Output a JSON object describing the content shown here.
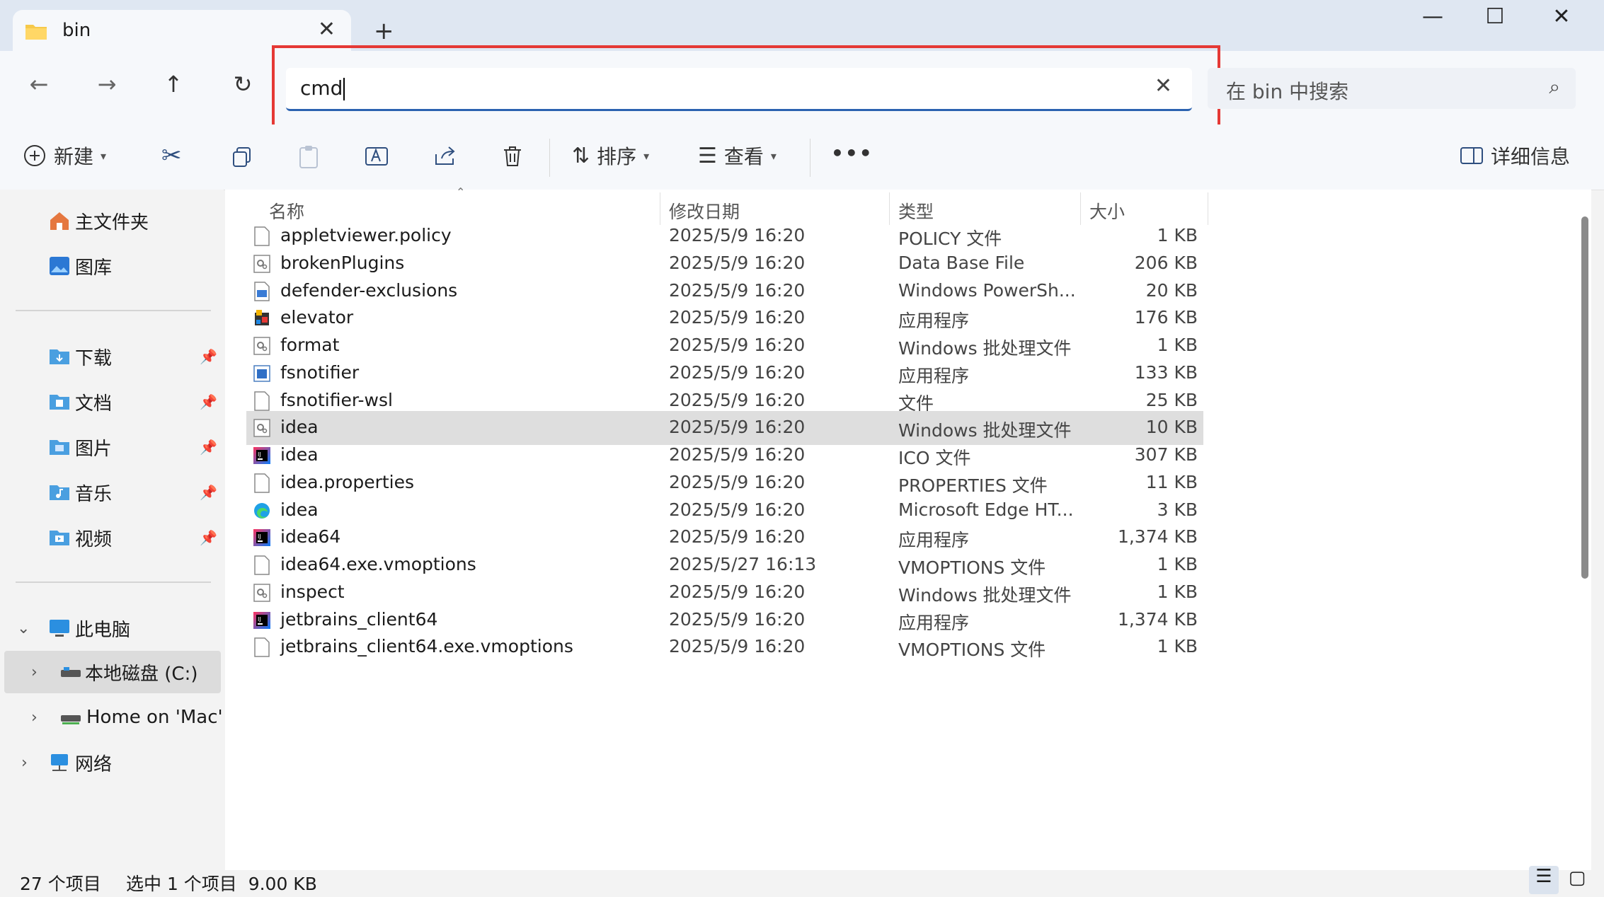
{
  "window": {
    "tab_title": "bin",
    "tab_close": "✕",
    "new_tab": "+",
    "minimize": "—",
    "maximize": "☐",
    "close": "✕"
  },
  "nav": {
    "back": "←",
    "forward": "→",
    "up": "↑",
    "refresh": "↻",
    "address_value": "cmd",
    "address_clear": "✕",
    "search_placeholder": "在 bin 中搜索",
    "search_icon": "⌕"
  },
  "toolbar": {
    "new_label": "新建",
    "sort_label": "排序",
    "view_label": "查看",
    "more": "•••",
    "details_label": "详细信息",
    "icons": [
      "plus-circle-icon",
      "cut-icon",
      "copy-icon",
      "paste-icon",
      "rename-icon",
      "share-icon",
      "delete-icon"
    ]
  },
  "sidebar": {
    "quick": [
      {
        "label": "主文件夹",
        "icon": "home-icon"
      },
      {
        "label": "图库",
        "icon": "gallery-icon"
      }
    ],
    "pinned": [
      {
        "label": "下载",
        "icon": "folder-download-icon"
      },
      {
        "label": "文档",
        "icon": "folder-docs-icon"
      },
      {
        "label": "图片",
        "icon": "folder-pictures-icon"
      },
      {
        "label": "音乐",
        "icon": "folder-music-icon"
      },
      {
        "label": "视频",
        "icon": "folder-video-icon"
      }
    ],
    "this_pc": "此电脑",
    "drive_c": "本地磁盘 (C:)",
    "home_mac": "Home on 'Mac' (",
    "network": "网络"
  },
  "columns": {
    "name": "名称",
    "date": "修改日期",
    "type": "类型",
    "size": "大小"
  },
  "files": [
    {
      "name": "appletviewer.policy",
      "date": "2025/5/9 16:20",
      "type": "POLICY 文件",
      "size": "1 KB",
      "icon": "blank"
    },
    {
      "name": "brokenPlugins",
      "date": "2025/5/9 16:20",
      "type": "Data Base File",
      "size": "206 KB",
      "icon": "gear"
    },
    {
      "name": "defender-exclusions",
      "date": "2025/5/9 16:20",
      "type": "Windows PowerSh...",
      "size": "20 KB",
      "icon": "ps"
    },
    {
      "name": "elevator",
      "date": "2025/5/9 16:20",
      "type": "应用程序",
      "size": "176 KB",
      "icon": "app"
    },
    {
      "name": "format",
      "date": "2025/5/9 16:20",
      "type": "Windows 批处理文件",
      "size": "1 KB",
      "icon": "gear"
    },
    {
      "name": "fsnotifier",
      "date": "2025/5/9 16:20",
      "type": "应用程序",
      "size": "133 KB",
      "icon": "win"
    },
    {
      "name": "fsnotifier-wsl",
      "date": "2025/5/9 16:20",
      "type": "文件",
      "size": "25 KB",
      "icon": "blank"
    },
    {
      "name": "idea",
      "date": "2025/5/9 16:20",
      "type": "Windows 批处理文件",
      "size": "10 KB",
      "icon": "gear"
    },
    {
      "name": "idea",
      "date": "2025/5/9 16:20",
      "type": "ICO 文件",
      "size": "307 KB",
      "icon": "jb"
    },
    {
      "name": "idea.properties",
      "date": "2025/5/9 16:20",
      "type": "PROPERTIES 文件",
      "size": "11 KB",
      "icon": "blank"
    },
    {
      "name": "idea",
      "date": "2025/5/9 16:20",
      "type": "Microsoft Edge HT...",
      "size": "3 KB",
      "icon": "edge"
    },
    {
      "name": "idea64",
      "date": "2025/5/9 16:20",
      "type": "应用程序",
      "size": "1,374 KB",
      "icon": "jb"
    },
    {
      "name": "idea64.exe.vmoptions",
      "date": "2025/5/27 16:13",
      "type": "VMOPTIONS 文件",
      "size": "1 KB",
      "icon": "blank"
    },
    {
      "name": "inspect",
      "date": "2025/5/9 16:20",
      "type": "Windows 批处理文件",
      "size": "1 KB",
      "icon": "gear"
    },
    {
      "name": "jetbrains_client64",
      "date": "2025/5/9 16:20",
      "type": "应用程序",
      "size": "1,374 KB",
      "icon": "jb"
    },
    {
      "name": "jetbrains_client64.exe.vmoptions",
      "date": "2025/5/9 16:20",
      "type": "VMOPTIONS 文件",
      "size": "1 KB",
      "icon": "blank"
    }
  ],
  "selected_index": 7,
  "status": {
    "count": "27 个项目",
    "selection": "选中 1 个项目  9.00 KB"
  }
}
